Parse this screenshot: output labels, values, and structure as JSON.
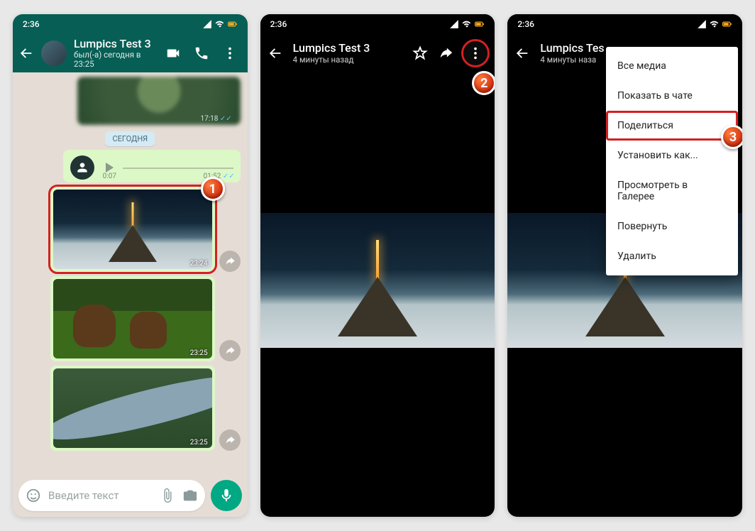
{
  "status": {
    "time": "2:36"
  },
  "badges": {
    "one": "1",
    "two": "2",
    "three": "3"
  },
  "screen1": {
    "header": {
      "name": "Lumpics Test 3",
      "status": "был(-а) сегодня в 23:25"
    },
    "prev_time": "17:18",
    "today": "СЕГОДНЯ",
    "voice": {
      "pos": "0:07",
      "dur": "01:52"
    },
    "imgs": {
      "t1": "23:24",
      "t2": "23:25",
      "t3": "23:25"
    },
    "input": {
      "placeholder": "Введите текст"
    }
  },
  "viewer": {
    "name": "Lumpics Test 3",
    "sub": "4 минуты назад",
    "name_clipped": "Lumpics Tes",
    "sub_clipped": "4 минуты наза"
  },
  "menu": {
    "all_media": "Все медиа",
    "show_in_chat": "Показать в чате",
    "share": "Поделиться",
    "set_as": "Установить как...",
    "view_gallery": "Просмотреть в Галерее",
    "rotate": "Повернуть",
    "delete": "Удалить"
  }
}
